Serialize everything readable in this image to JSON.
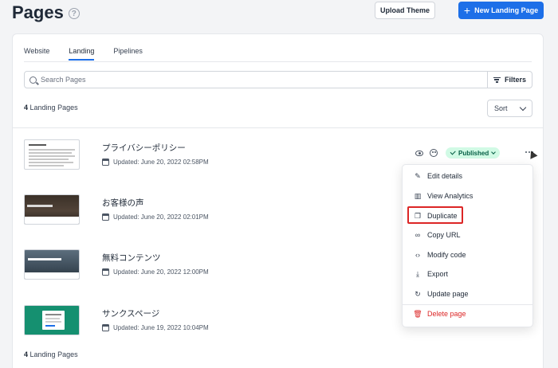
{
  "header": {
    "title": "Pages",
    "help_icon": "question-circle-icon",
    "upload_label": "Upload Theme",
    "new_label": "New Landing Page",
    "accent_color": "#1d6fe8"
  },
  "tabs": [
    {
      "label": "Website",
      "active": false
    },
    {
      "label": "Landing",
      "active": true
    },
    {
      "label": "Pipelines",
      "active": false
    }
  ],
  "search": {
    "placeholder": "Search Pages",
    "value": ""
  },
  "filters_label": "Filters",
  "sort_label": "Sort",
  "count": {
    "number": "4",
    "label": "Landing Pages"
  },
  "rows": [
    {
      "title": "プライバシーポリシー",
      "updated": "Updated: June 20, 2022 02:58PM",
      "thumb": "document"
    },
    {
      "title": "お客様の声",
      "updated": "Updated: June 20, 2022 02:01PM",
      "thumb": "dark-photo"
    },
    {
      "title": "無料コンテンツ",
      "updated": "Updated: June 20, 2022 12:00PM",
      "thumb": "blue-photo"
    },
    {
      "title": "サンクスページ",
      "updated": "Updated: June 19, 2022 10:04PM",
      "thumb": "green"
    }
  ],
  "row_actions": {
    "status": "Published",
    "status_color": "#d1fae5",
    "icons": [
      "eye-icon",
      "palette-icon",
      "more-icon"
    ]
  },
  "menu": {
    "items": [
      {
        "label": "Edit details",
        "icon": "pencil-icon"
      },
      {
        "label": "View Analytics",
        "icon": "bar-chart-icon"
      },
      {
        "label": "Duplicate",
        "icon": "copy-icon",
        "highlighted": true
      },
      {
        "label": "Copy URL",
        "icon": "link-icon"
      },
      {
        "label": "Modify code",
        "icon": "code-icon"
      },
      {
        "label": "Export",
        "icon": "download-icon"
      },
      {
        "label": "Update page",
        "icon": "refresh-icon"
      },
      {
        "label": "Delete page",
        "icon": "trash-icon",
        "danger": true
      }
    ]
  }
}
